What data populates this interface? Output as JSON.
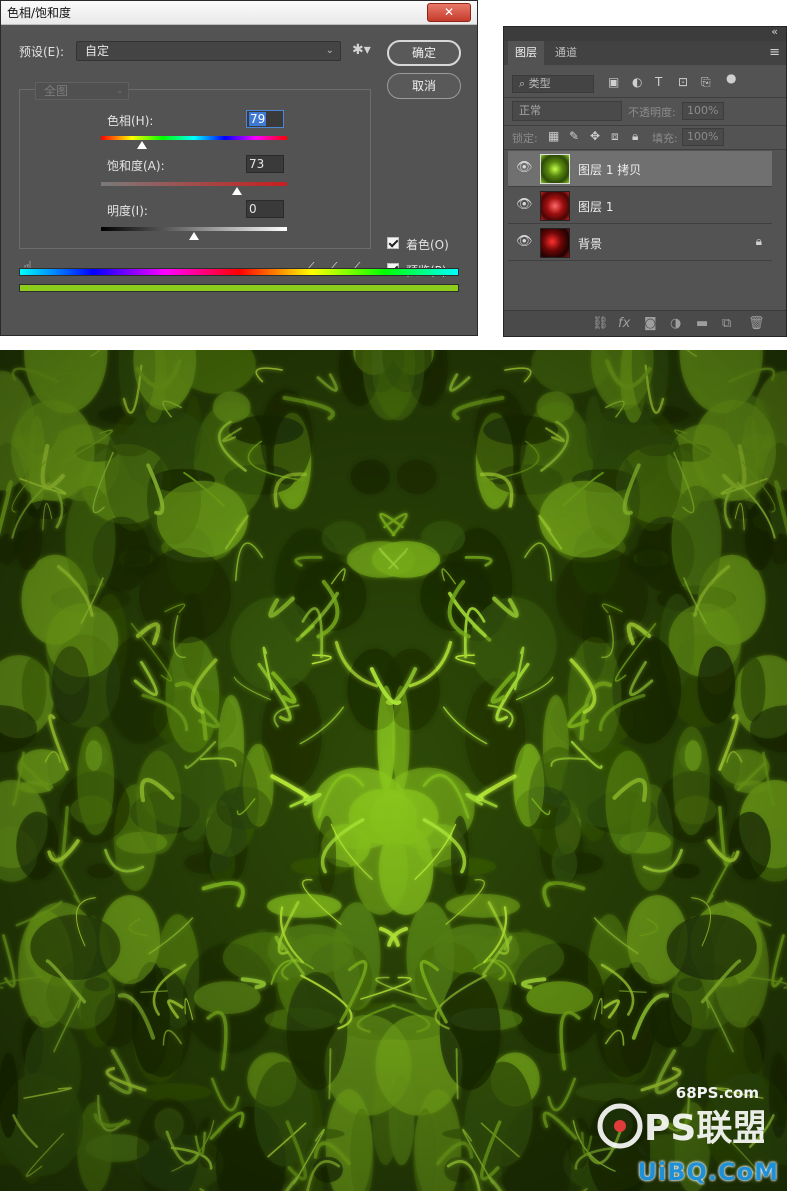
{
  "dialog": {
    "title": "色相/饱和度",
    "close_glyph": "✕",
    "preset_label": "预设(E):",
    "preset_value": "自定",
    "ok_label": "确定",
    "cancel_label": "取消",
    "channel_value": "全图",
    "hue_label": "色相(H):",
    "hue_value": "79",
    "saturation_label": "饱和度(A):",
    "saturation_value": "73",
    "lightness_label": "明度(I):",
    "lightness_value": "0",
    "colorize_label": "着色(O)",
    "preview_label": "预览(P)",
    "colorize_checked": true,
    "preview_checked": true,
    "hue_slider_fraction": 0.22,
    "saturation_slider_fraction": 0.73,
    "lightness_slider_fraction": 0.5,
    "result_color": "#8ccc1c"
  },
  "layers_panel": {
    "collapse_glyph": "«",
    "menu_glyph": "≡",
    "tabs": [
      "图层",
      "通道"
    ],
    "filter_label": "类型",
    "blend_mode": "正常",
    "opacity_label": "不透明度:",
    "opacity_value": "100%",
    "lock_label": "锁定:",
    "fill_label": "填充:",
    "fill_value": "100%",
    "layers": [
      {
        "name": "图层 1 拷贝",
        "selected": true,
        "locked": false,
        "thumb_color": "#6cb51a"
      },
      {
        "name": "图层 1",
        "selected": false,
        "locked": false,
        "thumb_color": "#b01818"
      },
      {
        "name": "背景",
        "selected": false,
        "locked": true,
        "thumb_color": "#8a0808"
      }
    ]
  },
  "canvas": {
    "base_color": "#2e4a08",
    "highlight_color": "#c8ff3c"
  },
  "watermark": {
    "site": "68PS.com",
    "brand": "PS联盟",
    "bottom": "UiBQ.CoM"
  }
}
